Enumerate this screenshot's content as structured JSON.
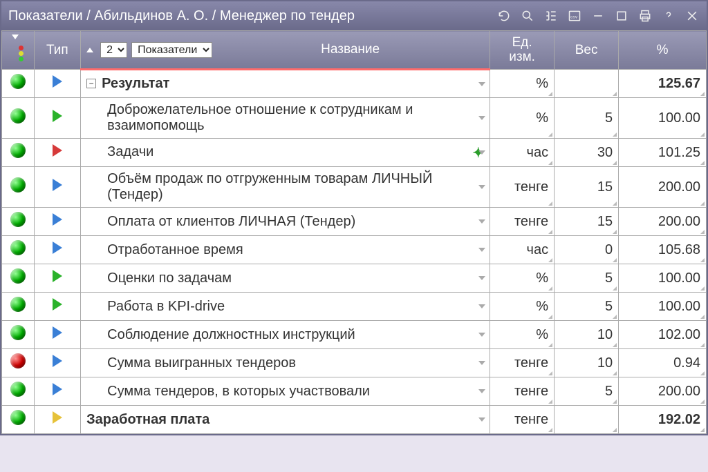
{
  "titlebar": {
    "breadcrumb": "Показатели / Абильдинов А. О. / Менеджер по тендер"
  },
  "headers": {
    "type": "Тип",
    "name": "Название",
    "unit_line1": "Ед.",
    "unit_line2": "изм.",
    "weight": "Вес",
    "percent": "%",
    "level_value": "2",
    "grouping_value": "Показатели"
  },
  "rows": [
    {
      "status": "green",
      "type_tri": "blue",
      "collapse": "-",
      "indent": false,
      "bold": true,
      "name": "Результат",
      "unit": "%",
      "weight": "",
      "percent": "125.67"
    },
    {
      "status": "green",
      "type_tri": "green",
      "collapse": "",
      "indent": true,
      "bold": false,
      "name": "Доброжелательное отношение к сотрудникам и взаимопомощь",
      "unit": "%",
      "weight": "5",
      "percent": "100.00"
    },
    {
      "status": "green",
      "type_tri": "red",
      "collapse": "",
      "indent": true,
      "bold": false,
      "name": "Задачи",
      "badge": "plus",
      "unit": "час",
      "weight": "30",
      "percent": "101.25"
    },
    {
      "status": "green",
      "type_tri": "blue",
      "collapse": "",
      "indent": true,
      "bold": false,
      "name": "Объём продаж по отгруженным товарам ЛИЧНЫЙ (Тендер)",
      "unit": "тенге",
      "weight": "15",
      "percent": "200.00"
    },
    {
      "status": "green",
      "type_tri": "blue",
      "collapse": "",
      "indent": true,
      "bold": false,
      "name": "Оплата от клиентов ЛИЧНАЯ (Тендер)",
      "unit": "тенге",
      "weight": "15",
      "percent": "200.00"
    },
    {
      "status": "green",
      "type_tri": "blue",
      "collapse": "",
      "indent": true,
      "bold": false,
      "name": "Отработанное время",
      "unit": "час",
      "weight": "0",
      "percent": "105.68"
    },
    {
      "status": "green",
      "type_tri": "green",
      "collapse": "",
      "indent": true,
      "bold": false,
      "name": "Оценки по задачам",
      "unit": "%",
      "weight": "5",
      "percent": "100.00"
    },
    {
      "status": "green",
      "type_tri": "green",
      "collapse": "",
      "indent": true,
      "bold": false,
      "name": "Работа в KPI-drive",
      "unit": "%",
      "weight": "5",
      "percent": "100.00"
    },
    {
      "status": "green",
      "type_tri": "blue",
      "collapse": "",
      "indent": true,
      "bold": false,
      "name": "Соблюдение должностных инструкций",
      "unit": "%",
      "weight": "10",
      "percent": "102.00"
    },
    {
      "status": "red",
      "type_tri": "blue",
      "collapse": "",
      "indent": true,
      "bold": false,
      "name": "Сумма выигранных тендеров",
      "unit": "тенге",
      "weight": "10",
      "percent": "0.94"
    },
    {
      "status": "green",
      "type_tri": "blue",
      "collapse": "",
      "indent": true,
      "bold": false,
      "name": "Сумма тендеров, в которых участвовали",
      "unit": "тенге",
      "weight": "5",
      "percent": "200.00"
    },
    {
      "status": "green",
      "type_tri": "yellow",
      "collapse": "",
      "indent": false,
      "bold": true,
      "name": "Заработная плата",
      "unit": "тенге",
      "weight": "",
      "percent": "192.02"
    }
  ]
}
